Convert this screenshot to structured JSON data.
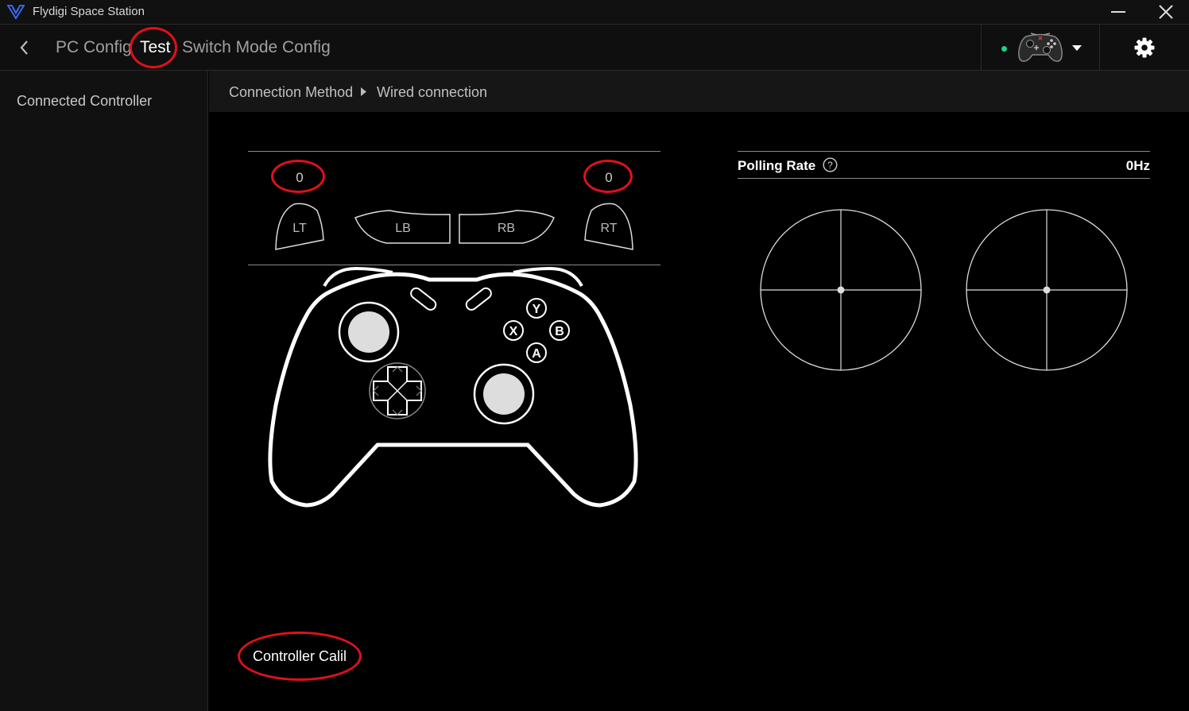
{
  "window": {
    "title": "Flydigi Space Station"
  },
  "nav": {
    "tabs": [
      {
        "label": "PC Config"
      },
      {
        "label": "Test"
      },
      {
        "label": "Switch Mode Config"
      }
    ],
    "connection_status_color": "#1fd18a"
  },
  "sidebar": {
    "items": [
      {
        "label": "Connected Controller"
      }
    ]
  },
  "breadcrumb": {
    "items": [
      "Connection Method",
      "Wired connection"
    ]
  },
  "test": {
    "left_trigger_value": "0",
    "right_trigger_value": "0",
    "buttons": {
      "lt": "LT",
      "lb": "LB",
      "rb": "RB",
      "rt": "RT",
      "y": "Y",
      "x": "X",
      "b": "B",
      "a": "A"
    },
    "polling_rate_label": "Polling Rate",
    "polling_rate_help": "?",
    "polling_rate_value": "0Hz",
    "calibration_button": "Controller Calil"
  },
  "colors": {
    "annotation": "#e0101a",
    "background": "#000000"
  }
}
